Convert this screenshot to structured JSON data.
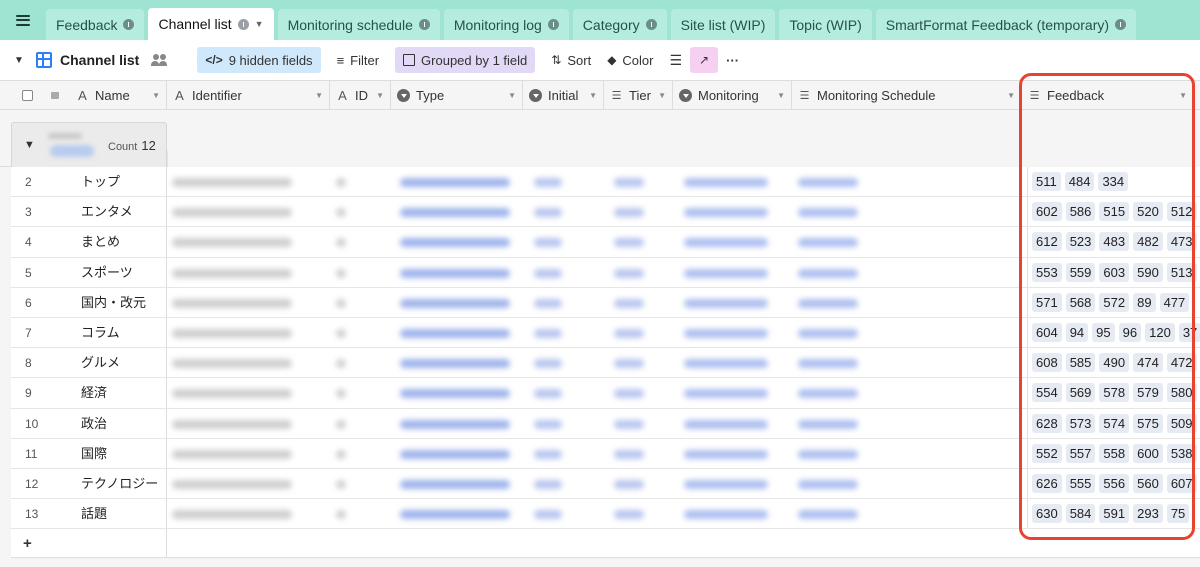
{
  "tabs": [
    {
      "label": "Feedback",
      "info": true
    },
    {
      "label": "Channel list",
      "info": true,
      "active": true,
      "caret": true
    },
    {
      "label": "Monitoring schedule",
      "info": true
    },
    {
      "label": "Monitoring log",
      "info": true
    },
    {
      "label": "Category",
      "info": true
    },
    {
      "label": "Site list (WIP)"
    },
    {
      "label": "Topic (WIP)"
    },
    {
      "label": "SmartFormat Feedback (temporary)",
      "info": true
    }
  ],
  "toolbar": {
    "view_name": "Channel list",
    "hidden_fields": "9 hidden fields",
    "filter": "Filter",
    "grouped": "Grouped by 1 field",
    "sort": "Sort",
    "color": "Color",
    "more": "···"
  },
  "columns": [
    {
      "name": "Name",
      "icon": "A"
    },
    {
      "name": "Identifier",
      "icon": "A"
    },
    {
      "name": "ID",
      "icon": "A"
    },
    {
      "name": "Type",
      "icon": "circle"
    },
    {
      "name": "Initial",
      "icon": "circle"
    },
    {
      "name": "Tier",
      "icon": "lines"
    },
    {
      "name": "Monitoring",
      "icon": "circle"
    },
    {
      "name": "Monitoring Schedule",
      "icon": "lines"
    },
    {
      "name": "Feedback",
      "icon": "lines"
    }
  ],
  "group": {
    "count_label": "Count",
    "count": "12"
  },
  "rows": [
    {
      "num": "2",
      "name": "トップ",
      "feedback": [
        "511",
        "484",
        "334"
      ]
    },
    {
      "num": "3",
      "name": "エンタメ",
      "feedback": [
        "602",
        "586",
        "515",
        "520",
        "512"
      ]
    },
    {
      "num": "4",
      "name": "まとめ",
      "feedback": [
        "612",
        "523",
        "483",
        "482",
        "473"
      ]
    },
    {
      "num": "5",
      "name": "スポーツ",
      "feedback": [
        "553",
        "559",
        "603",
        "590",
        "513"
      ]
    },
    {
      "num": "6",
      "name": "国内・改元",
      "feedback": [
        "571",
        "568",
        "572",
        "89",
        "477"
      ]
    },
    {
      "num": "7",
      "name": "コラム",
      "feedback": [
        "604",
        "94",
        "95",
        "96",
        "120",
        "37"
      ]
    },
    {
      "num": "8",
      "name": "グルメ",
      "feedback": [
        "608",
        "585",
        "490",
        "474",
        "472"
      ]
    },
    {
      "num": "9",
      "name": "経済",
      "feedback": [
        "554",
        "569",
        "578",
        "579",
        "580"
      ]
    },
    {
      "num": "10",
      "name": "政治",
      "feedback": [
        "628",
        "573",
        "574",
        "575",
        "509"
      ]
    },
    {
      "num": "11",
      "name": "国際",
      "feedback": [
        "552",
        "557",
        "558",
        "600",
        "538"
      ]
    },
    {
      "num": "12",
      "name": "テクノロジー",
      "feedback": [
        "626",
        "555",
        "556",
        "560",
        "607"
      ]
    },
    {
      "num": "13",
      "name": "話題",
      "feedback": [
        "630",
        "584",
        "591",
        "293",
        "75"
      ]
    }
  ],
  "add_row": "+"
}
